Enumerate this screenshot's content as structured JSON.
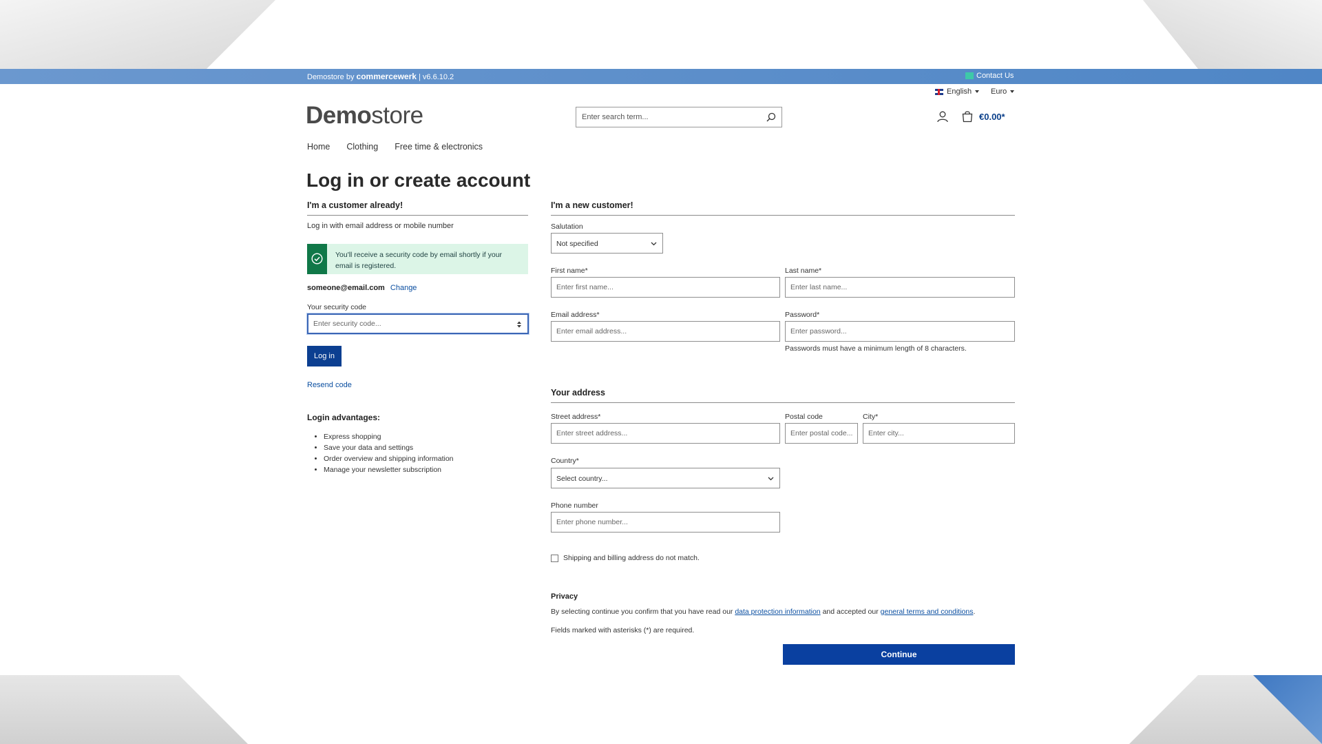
{
  "topbar": {
    "brand_prefix": "Demostore by ",
    "brand_name": "commercewerk",
    "version": " | v6.6.10.2",
    "contact": "Contact Us"
  },
  "header": {
    "logo_bold": "Demo",
    "logo_light": "store",
    "search_placeholder": "Enter search term...",
    "language": "English",
    "currency": "Euro",
    "cart_total": "€0.00*"
  },
  "nav": {
    "items": [
      "Home",
      "Clothing",
      "Free time & electronics"
    ]
  },
  "page_title": "Log in or create account",
  "login": {
    "title": "I'm a customer already!",
    "subtitle": "Log in with email address or mobile number",
    "notice": "You'll receive a security code by email shortly if your email is registered.",
    "email": "someone@email.com",
    "change": "Change",
    "code_label": "Your security code",
    "code_placeholder": "Enter security code...",
    "login_button": "Log in",
    "resend": "Resend code",
    "advantages_title": "Login advantages:",
    "advantages": [
      "Express shopping",
      "Save your data and settings",
      "Order overview and shipping information",
      "Manage your newsletter subscription"
    ]
  },
  "register": {
    "title": "I'm a new customer!",
    "salutation_label": "Salutation",
    "salutation_value": "Not specified",
    "first_name_label": "First name*",
    "first_name_placeholder": "Enter first name...",
    "last_name_label": "Last name*",
    "last_name_placeholder": "Enter last name...",
    "email_label": "Email address*",
    "email_placeholder": "Enter email address...",
    "password_label": "Password*",
    "password_placeholder": "Enter password...",
    "password_help": "Passwords must have a minimum length of 8 characters.",
    "address_title": "Your address",
    "street_label": "Street address*",
    "street_placeholder": "Enter street address...",
    "postal_label": "Postal code",
    "postal_placeholder": "Enter postal code...",
    "city_label": "City*",
    "city_placeholder": "Enter city...",
    "country_label": "Country*",
    "country_value": "Select country...",
    "phone_label": "Phone number",
    "phone_placeholder": "Enter phone number...",
    "shipping_checkbox": "Shipping and billing address do not match.",
    "privacy_title": "Privacy",
    "privacy_pre": "By selecting continue you confirm that you have read our ",
    "privacy_link1": "data protection information",
    "privacy_mid": " and accepted our ",
    "privacy_link2": "general terms and conditions",
    "privacy_post": ".",
    "required_note": "Fields marked with asterisks (*) are required.",
    "continue_button": "Continue"
  },
  "colors": {
    "primary": "#0a40a0",
    "topbar": "#5b8fcb",
    "success": "#107848",
    "success_bg": "#dcf5e7"
  }
}
